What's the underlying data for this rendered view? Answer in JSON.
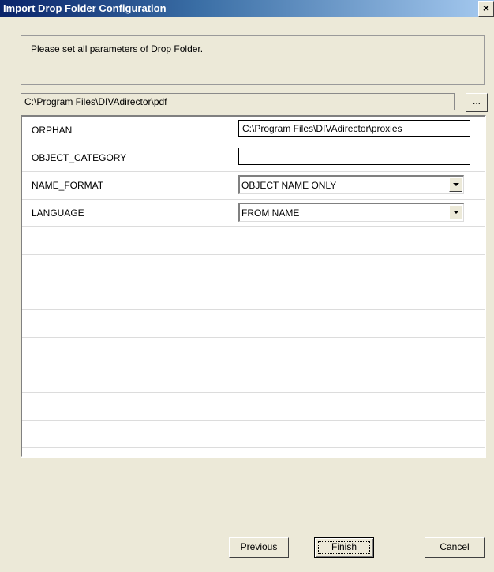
{
  "window": {
    "title": "Import Drop Folder Configuration",
    "close_glyph": "×"
  },
  "info": {
    "message": "Please set all parameters of Drop Folder."
  },
  "path": {
    "value": "C:\\Program Files\\DIVAdirector\\pdf",
    "browse_label": "..."
  },
  "grid": {
    "rows": [
      {
        "name": "ORPHAN",
        "type": "text",
        "value": "C:\\Program Files\\DIVAdirector\\proxies"
      },
      {
        "name": "OBJECT_CATEGORY",
        "type": "text",
        "value": ""
      },
      {
        "name": "NAME_FORMAT",
        "type": "combo",
        "value": "OBJECT NAME ONLY"
      },
      {
        "name": "LANGUAGE",
        "type": "combo",
        "value": "FROM NAME"
      }
    ],
    "empty_rows": 8
  },
  "buttons": {
    "previous": "Previous",
    "finish": "Finish",
    "cancel": "Cancel"
  },
  "icons": {
    "close": "close-icon",
    "dropdown": "chevron-down-icon"
  }
}
